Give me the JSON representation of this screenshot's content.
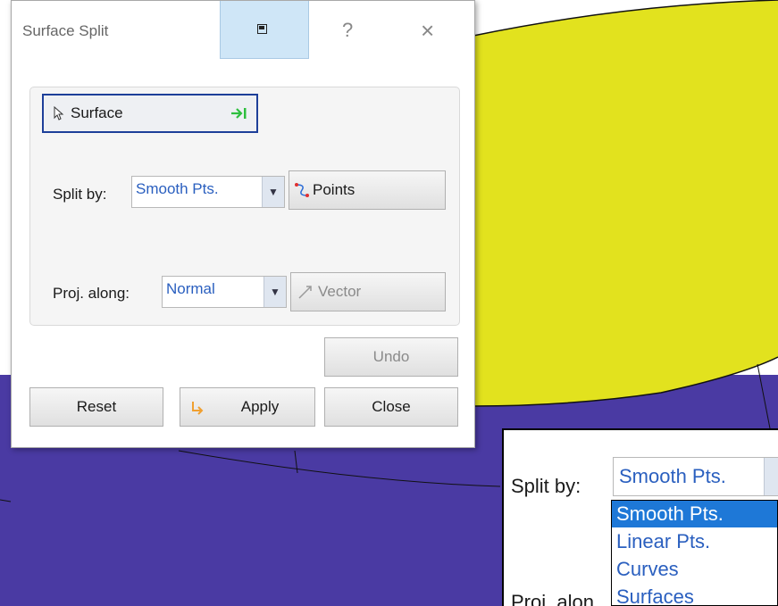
{
  "dialog": {
    "title": "Surface Split",
    "help_label": "?",
    "close_label": "×",
    "surface_button_label": "Surface",
    "split_by_label": "Split by:",
    "split_by_value": "Smooth Pts.",
    "points_button_label": "Points",
    "proj_along_label": "Proj. along:",
    "proj_along_value": "Normal",
    "vector_button_label": "Vector",
    "undo_label": "Undo",
    "reset_label": "Reset",
    "apply_label": "Apply",
    "close_button_label": "Close"
  },
  "zoom_inset": {
    "split_by_label": "Split by:",
    "split_by_value": "Smooth Pts.",
    "proj_along_partial": "Proj. alon",
    "options": [
      "Smooth Pts.",
      "Linear Pts.",
      "Curves",
      "Surfaces"
    ],
    "selected_option": "Smooth Pts."
  },
  "colors": {
    "model_yellow": "#e2e21e",
    "model_purple": "#4a3aa3",
    "selection_blue": "#1e78d7",
    "combo_text": "#2a5fbf"
  },
  "icons": [
    "cursor-icon",
    "arrow-right-bar-icon",
    "points-icon",
    "vector-icon",
    "apply-arrow-icon",
    "restore-icon",
    "help-icon",
    "close-icon"
  ]
}
